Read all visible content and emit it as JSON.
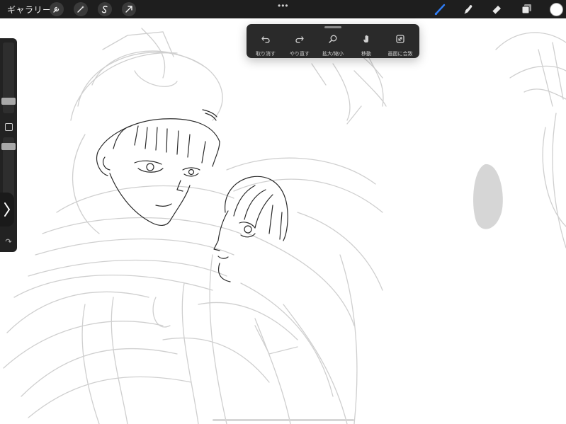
{
  "topbar": {
    "gallery_label": "ギャラリー",
    "left_tools": [
      "wrench-icon",
      "magic-wand-icon",
      "selection-icon",
      "transform-arrow-icon"
    ],
    "menu_dots": "•••",
    "right_tools": [
      "brush-icon",
      "smudge-icon",
      "eraser-icon",
      "layers-icon"
    ],
    "brush_active_color": "#2f7df6",
    "current_color": "#ffffff"
  },
  "sidebar": {
    "expand_glyph": "⟩",
    "undo_glyph": "↶",
    "redo_glyph": "↷"
  },
  "gesture_popover": {
    "items": [
      {
        "icon": "undo-icon",
        "label": "取り消す"
      },
      {
        "icon": "redo-icon",
        "label": "やり直す"
      },
      {
        "icon": "zoom-icon",
        "label": "拡大/縮小"
      },
      {
        "icon": "hand-icon",
        "label": "移動"
      },
      {
        "icon": "fit-screen-icon",
        "label": "画面に合致"
      }
    ]
  }
}
